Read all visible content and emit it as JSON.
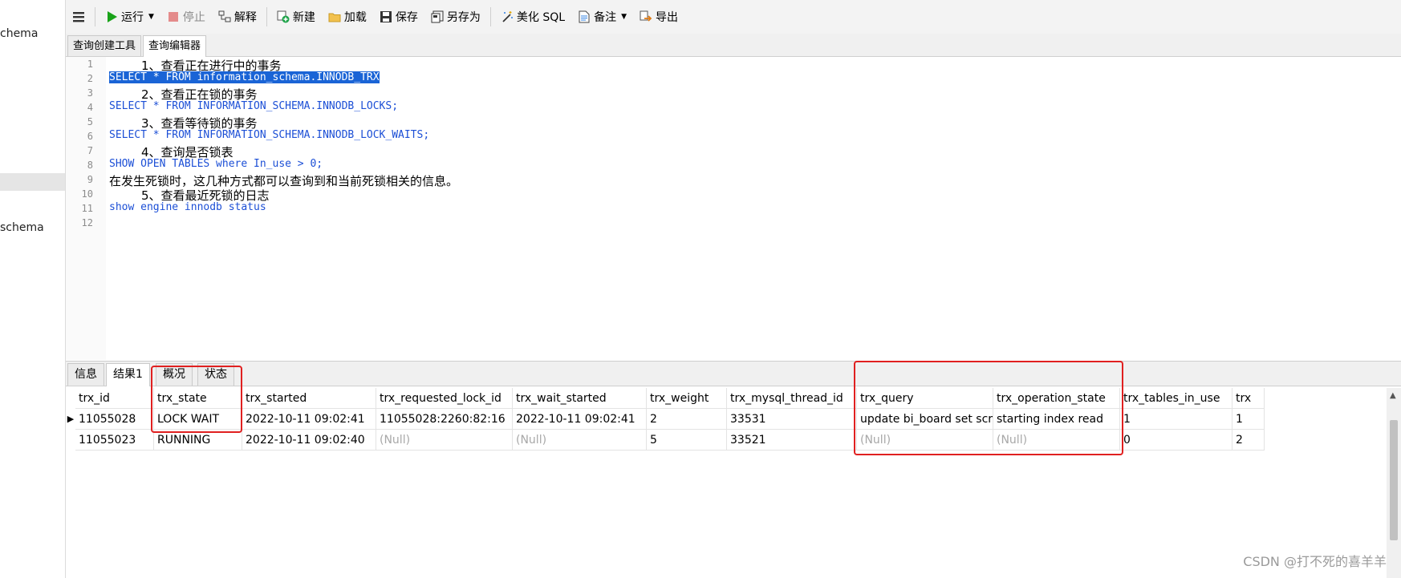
{
  "left_panel": {
    "items": [
      "chema",
      "schema"
    ]
  },
  "toolbar": {
    "run": "运行",
    "stop": "停止",
    "explain": "解释",
    "new": "新建",
    "load": "加载",
    "save": "保存",
    "save_as": "另存为",
    "beautify": "美化 SQL",
    "comment": "备注",
    "export": "导出"
  },
  "editor_tabs": [
    "查询创建工具",
    "查询编辑器"
  ],
  "editor": {
    "lines": [
      "1、查看正在进行中的事务",
      "SELECT * FROM information_schema.INNODB_TRX",
      "2、查看正在锁的事务",
      "SELECT * FROM INFORMATION_SCHEMA.INNODB_LOCKS;",
      "3、查看等待锁的事务",
      "SELECT * FROM INFORMATION_SCHEMA.INNODB_LOCK_WAITS;",
      "4、查询是否锁表",
      "SHOW OPEN TABLES where In_use > 0;",
      "在发生死锁时，这几种方式都可以查询到和当前死锁相关的信息。",
      "5、查看最近死锁的日志",
      "show engine innodb status",
      ""
    ]
  },
  "result_tabs": [
    "信息",
    "结果1",
    "概况",
    "状态"
  ],
  "grid": {
    "columns": [
      "trx_id",
      "trx_state",
      "trx_started",
      "trx_requested_lock_id",
      "trx_wait_started",
      "trx_weight",
      "trx_mysql_thread_id",
      "trx_query",
      "trx_operation_state",
      "trx_tables_in_use",
      "trx"
    ],
    "rows": [
      [
        "11055028",
        "LOCK WAIT",
        "2022-10-11 09:02:41",
        "11055028:2260:82:16",
        "2022-10-11 09:02:41",
        "2",
        "33531",
        "update bi_board set scre",
        "starting index read",
        "1",
        "1"
      ],
      [
        "11055023",
        "RUNNING",
        "2022-10-11 09:02:40",
        "(Null)",
        "(Null)",
        "5",
        "33521",
        "(Null)",
        "(Null)",
        "0",
        "2"
      ]
    ]
  },
  "watermark": "CSDN @打不死的喜羊羊",
  "colors": {
    "highlight_box": "#e02020",
    "selection": "#1a64d6",
    "keyword": "#1c4fd6"
  }
}
